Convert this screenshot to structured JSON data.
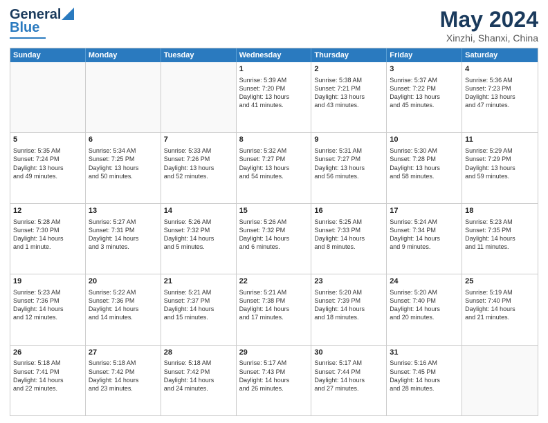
{
  "logo": {
    "line1": "General",
    "line2": "Blue"
  },
  "title": {
    "month_year": "May 2024",
    "location": "Xinzhi, Shanxi, China"
  },
  "weekdays": [
    "Sunday",
    "Monday",
    "Tuesday",
    "Wednesday",
    "Thursday",
    "Friday",
    "Saturday"
  ],
  "rows": [
    [
      {
        "day": "",
        "lines": []
      },
      {
        "day": "",
        "lines": []
      },
      {
        "day": "",
        "lines": []
      },
      {
        "day": "1",
        "lines": [
          "Sunrise: 5:39 AM",
          "Sunset: 7:20 PM",
          "Daylight: 13 hours",
          "and 41 minutes."
        ]
      },
      {
        "day": "2",
        "lines": [
          "Sunrise: 5:38 AM",
          "Sunset: 7:21 PM",
          "Daylight: 13 hours",
          "and 43 minutes."
        ]
      },
      {
        "day": "3",
        "lines": [
          "Sunrise: 5:37 AM",
          "Sunset: 7:22 PM",
          "Daylight: 13 hours",
          "and 45 minutes."
        ]
      },
      {
        "day": "4",
        "lines": [
          "Sunrise: 5:36 AM",
          "Sunset: 7:23 PM",
          "Daylight: 13 hours",
          "and 47 minutes."
        ]
      }
    ],
    [
      {
        "day": "5",
        "lines": [
          "Sunrise: 5:35 AM",
          "Sunset: 7:24 PM",
          "Daylight: 13 hours",
          "and 49 minutes."
        ]
      },
      {
        "day": "6",
        "lines": [
          "Sunrise: 5:34 AM",
          "Sunset: 7:25 PM",
          "Daylight: 13 hours",
          "and 50 minutes."
        ]
      },
      {
        "day": "7",
        "lines": [
          "Sunrise: 5:33 AM",
          "Sunset: 7:26 PM",
          "Daylight: 13 hours",
          "and 52 minutes."
        ]
      },
      {
        "day": "8",
        "lines": [
          "Sunrise: 5:32 AM",
          "Sunset: 7:27 PM",
          "Daylight: 13 hours",
          "and 54 minutes."
        ]
      },
      {
        "day": "9",
        "lines": [
          "Sunrise: 5:31 AM",
          "Sunset: 7:27 PM",
          "Daylight: 13 hours",
          "and 56 minutes."
        ]
      },
      {
        "day": "10",
        "lines": [
          "Sunrise: 5:30 AM",
          "Sunset: 7:28 PM",
          "Daylight: 13 hours",
          "and 58 minutes."
        ]
      },
      {
        "day": "11",
        "lines": [
          "Sunrise: 5:29 AM",
          "Sunset: 7:29 PM",
          "Daylight: 13 hours",
          "and 59 minutes."
        ]
      }
    ],
    [
      {
        "day": "12",
        "lines": [
          "Sunrise: 5:28 AM",
          "Sunset: 7:30 PM",
          "Daylight: 14 hours",
          "and 1 minute."
        ]
      },
      {
        "day": "13",
        "lines": [
          "Sunrise: 5:27 AM",
          "Sunset: 7:31 PM",
          "Daylight: 14 hours",
          "and 3 minutes."
        ]
      },
      {
        "day": "14",
        "lines": [
          "Sunrise: 5:26 AM",
          "Sunset: 7:32 PM",
          "Daylight: 14 hours",
          "and 5 minutes."
        ]
      },
      {
        "day": "15",
        "lines": [
          "Sunrise: 5:26 AM",
          "Sunset: 7:32 PM",
          "Daylight: 14 hours",
          "and 6 minutes."
        ]
      },
      {
        "day": "16",
        "lines": [
          "Sunrise: 5:25 AM",
          "Sunset: 7:33 PM",
          "Daylight: 14 hours",
          "and 8 minutes."
        ]
      },
      {
        "day": "17",
        "lines": [
          "Sunrise: 5:24 AM",
          "Sunset: 7:34 PM",
          "Daylight: 14 hours",
          "and 9 minutes."
        ]
      },
      {
        "day": "18",
        "lines": [
          "Sunrise: 5:23 AM",
          "Sunset: 7:35 PM",
          "Daylight: 14 hours",
          "and 11 minutes."
        ]
      }
    ],
    [
      {
        "day": "19",
        "lines": [
          "Sunrise: 5:23 AM",
          "Sunset: 7:36 PM",
          "Daylight: 14 hours",
          "and 12 minutes."
        ]
      },
      {
        "day": "20",
        "lines": [
          "Sunrise: 5:22 AM",
          "Sunset: 7:36 PM",
          "Daylight: 14 hours",
          "and 14 minutes."
        ]
      },
      {
        "day": "21",
        "lines": [
          "Sunrise: 5:21 AM",
          "Sunset: 7:37 PM",
          "Daylight: 14 hours",
          "and 15 minutes."
        ]
      },
      {
        "day": "22",
        "lines": [
          "Sunrise: 5:21 AM",
          "Sunset: 7:38 PM",
          "Daylight: 14 hours",
          "and 17 minutes."
        ]
      },
      {
        "day": "23",
        "lines": [
          "Sunrise: 5:20 AM",
          "Sunset: 7:39 PM",
          "Daylight: 14 hours",
          "and 18 minutes."
        ]
      },
      {
        "day": "24",
        "lines": [
          "Sunrise: 5:20 AM",
          "Sunset: 7:40 PM",
          "Daylight: 14 hours",
          "and 20 minutes."
        ]
      },
      {
        "day": "25",
        "lines": [
          "Sunrise: 5:19 AM",
          "Sunset: 7:40 PM",
          "Daylight: 14 hours",
          "and 21 minutes."
        ]
      }
    ],
    [
      {
        "day": "26",
        "lines": [
          "Sunrise: 5:18 AM",
          "Sunset: 7:41 PM",
          "Daylight: 14 hours",
          "and 22 minutes."
        ]
      },
      {
        "day": "27",
        "lines": [
          "Sunrise: 5:18 AM",
          "Sunset: 7:42 PM",
          "Daylight: 14 hours",
          "and 23 minutes."
        ]
      },
      {
        "day": "28",
        "lines": [
          "Sunrise: 5:18 AM",
          "Sunset: 7:42 PM",
          "Daylight: 14 hours",
          "and 24 minutes."
        ]
      },
      {
        "day": "29",
        "lines": [
          "Sunrise: 5:17 AM",
          "Sunset: 7:43 PM",
          "Daylight: 14 hours",
          "and 26 minutes."
        ]
      },
      {
        "day": "30",
        "lines": [
          "Sunrise: 5:17 AM",
          "Sunset: 7:44 PM",
          "Daylight: 14 hours",
          "and 27 minutes."
        ]
      },
      {
        "day": "31",
        "lines": [
          "Sunrise: 5:16 AM",
          "Sunset: 7:45 PM",
          "Daylight: 14 hours",
          "and 28 minutes."
        ]
      },
      {
        "day": "",
        "lines": []
      }
    ]
  ]
}
